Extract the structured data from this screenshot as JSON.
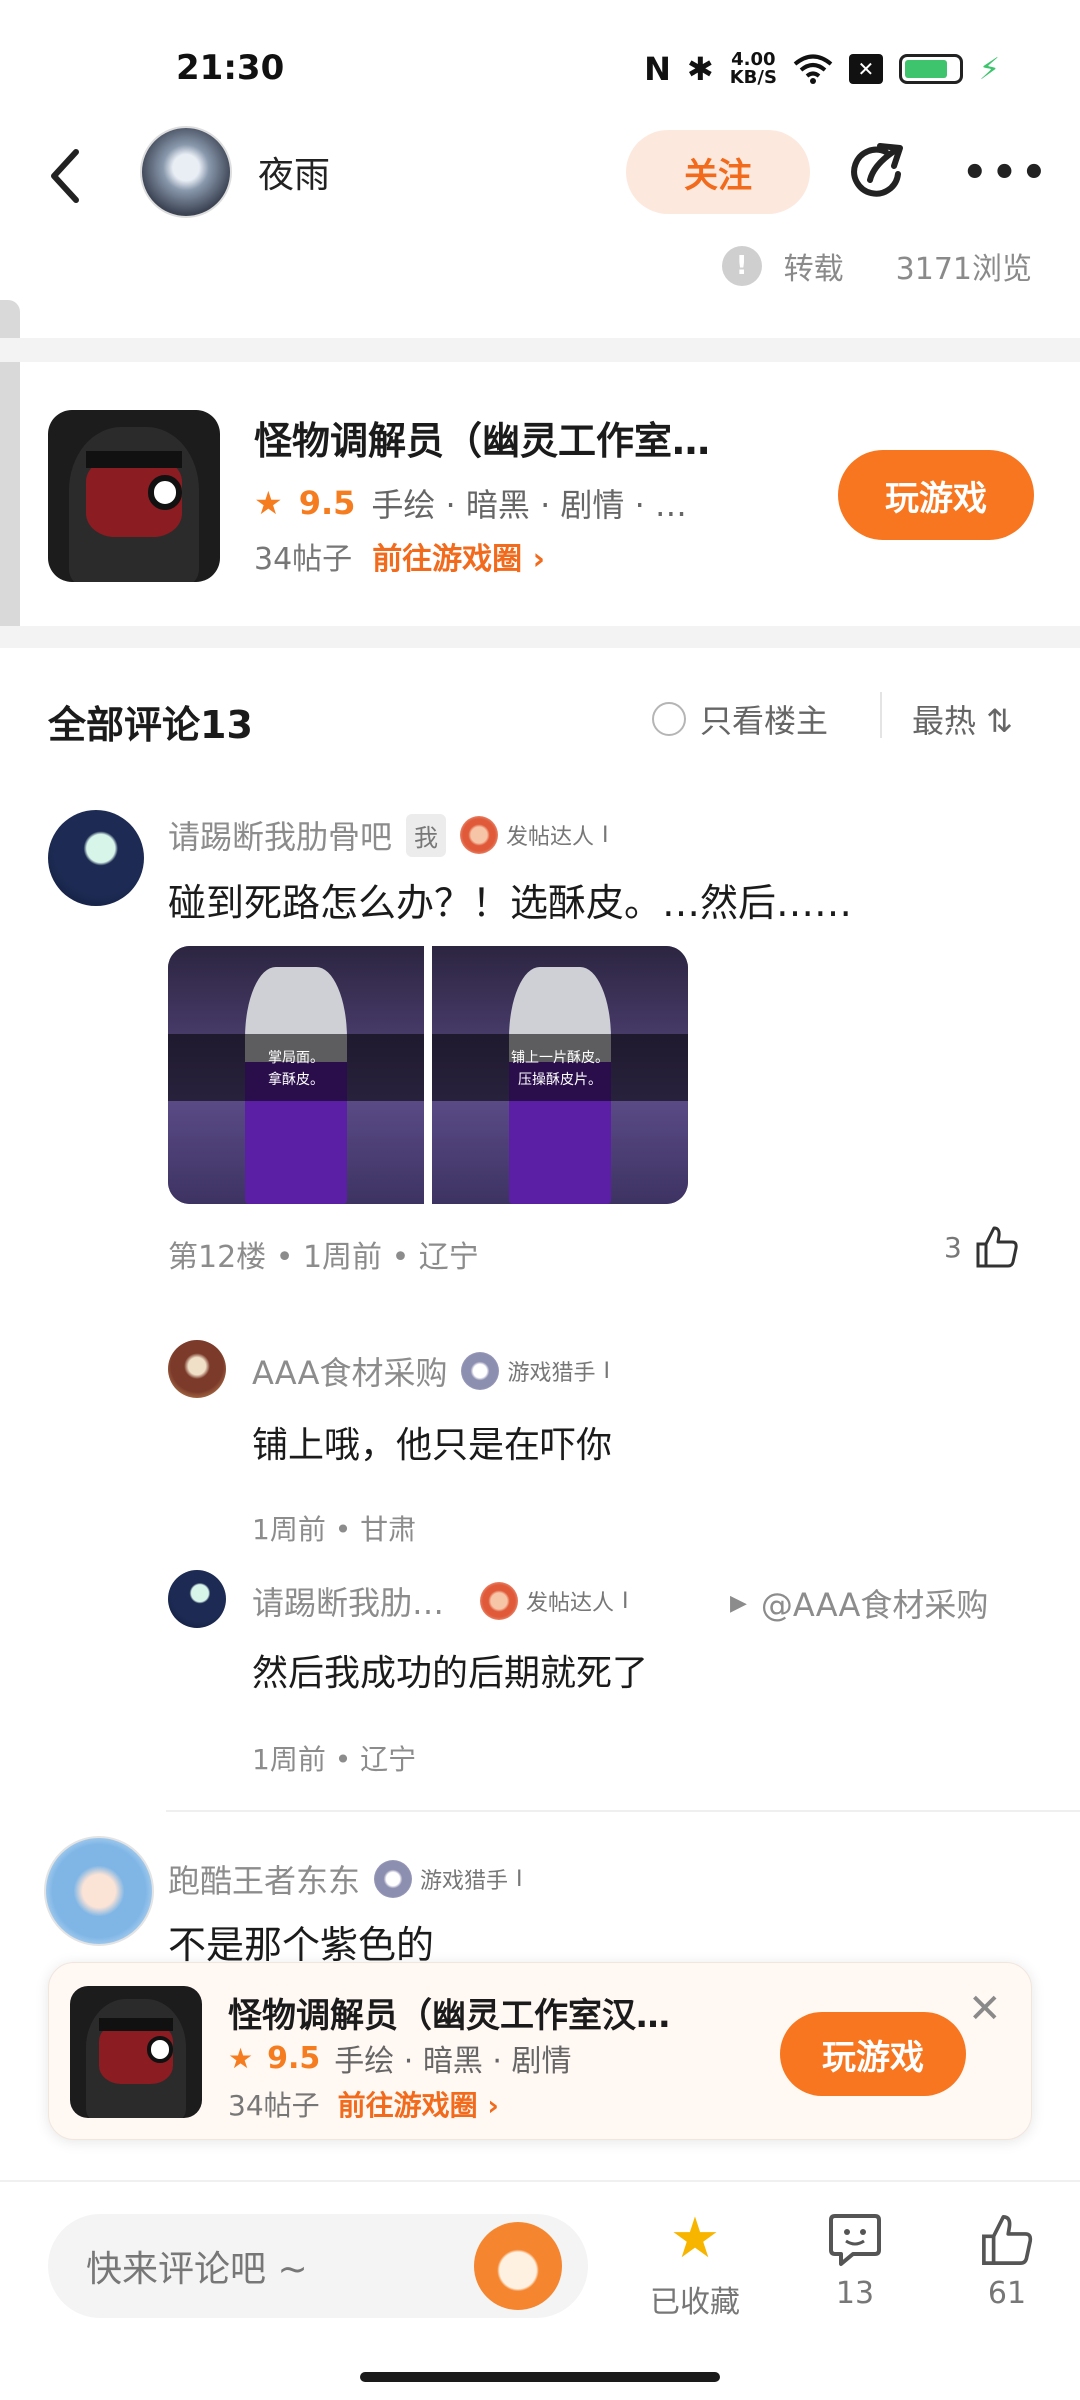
{
  "status_bar": {
    "time": "21:30",
    "nfc_icon": "N",
    "bluetooth_icon": "✱",
    "net_speed_value": "4.00",
    "net_speed_unit": "KB/S",
    "wifi_icon": "wifi",
    "sim_icon": "✕",
    "battery_color": "#3ec46d",
    "charging_icon": "⚡"
  },
  "header": {
    "author_name": "夜雨",
    "follow_label": "关注",
    "more_icon": "•••",
    "repost_label": "转载",
    "views": "3171浏览"
  },
  "game_card": {
    "title": "怪物调解员（幽灵工作室…",
    "rating": "9.5",
    "tags": "手绘 · 暗黑 · 剧情 · …",
    "posts": "34帖子",
    "goto_label": "前往游戏圈",
    "play_label": "玩游戏"
  },
  "comments": {
    "title": "全部评论13",
    "only_op_label": "只看楼主",
    "sort_label": "最热 ⇅",
    "items": [
      {
        "name": "请踢断我肋骨吧",
        "me_badge": "我",
        "badge": "发帖达人",
        "badge_suffix": "I",
        "text": "碰到死路怎么办？！选酥皮。…然后……",
        "images": [
          {
            "caption_1": "掌局面。",
            "caption_2": "拿酥皮。"
          },
          {
            "caption_1": "铺上一片酥皮。",
            "caption_2": "压操酥皮片。"
          }
        ],
        "meta": "第12楼 • 1周前 • 辽宁",
        "likes": "3"
      }
    ],
    "replies": [
      {
        "name": "AAA食材采购",
        "badge": "游戏猎手",
        "badge_suffix": "I",
        "text": "铺上哦，他只是在吓你",
        "meta": "1周前 • 甘肃"
      },
      {
        "name": "请踢断我肋…",
        "badge": "发帖达人",
        "badge_suffix": "I",
        "reply_arrow": "▶",
        "reply_to": "@AAA食材采购",
        "text": "然后我成功的后期就死了",
        "meta": "1周前 • 辽宁"
      }
    ],
    "second": {
      "name": "跑酷王者东东",
      "badge": "游戏猎手",
      "badge_suffix": "I",
      "text": "不是那个紫色的"
    }
  },
  "floating_card": {
    "title": "怪物调解员（幽灵工作室汉…",
    "rating": "9.5",
    "tags": "手绘 · 暗黑 · 剧情",
    "posts": "34帖子",
    "goto_label": "前往游戏圈",
    "play_label": "玩游戏",
    "close_icon": "✕"
  },
  "bottom_bar": {
    "comment_placeholder": "快来评论吧 ~",
    "favorite_label": "已收藏",
    "favorite_icon": "★",
    "comment_count": "13",
    "like_count": "61"
  },
  "colors": {
    "accent": "#f7761f",
    "follow_bg": "#fde8dd",
    "star": "#f7b500"
  }
}
